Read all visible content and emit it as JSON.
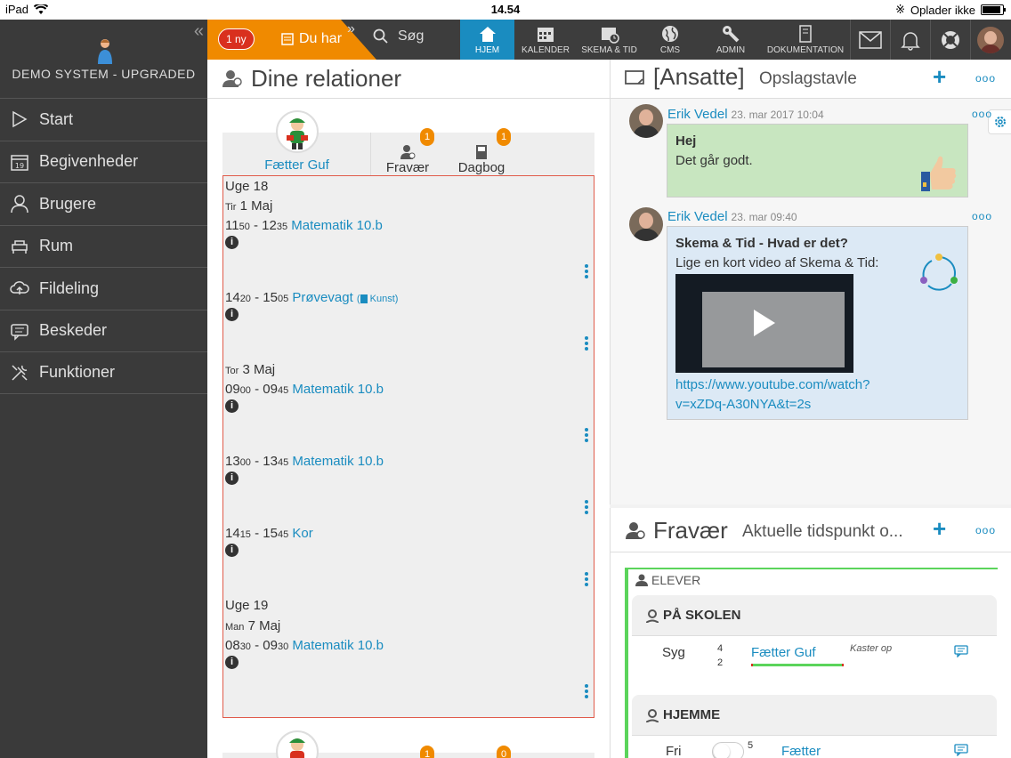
{
  "statusbar": {
    "device": "iPad",
    "time": "14.54",
    "charging": "Oplader ikke"
  },
  "sidebar": {
    "system_name": "DEMO SYSTEM - UPGRADED",
    "items": [
      {
        "label": "Start",
        "icon": "play-icon"
      },
      {
        "label": "Begivenheder",
        "icon": "calendar-icon"
      },
      {
        "label": "Brugere",
        "icon": "users-icon"
      },
      {
        "label": "Rum",
        "icon": "room-icon"
      },
      {
        "label": "Fildeling",
        "icon": "cloud-icon"
      },
      {
        "label": "Beskeder",
        "icon": "messages-icon"
      },
      {
        "label": "Funktioner",
        "icon": "tools-icon"
      }
    ]
  },
  "topnav": {
    "new_badge": "1 ny",
    "notice": "Du har",
    "search": "Søg",
    "items": [
      {
        "label": "HJEM",
        "active": true
      },
      {
        "label": "KALENDER"
      },
      {
        "label": "SKEMA & TID"
      },
      {
        "label": "CMS"
      },
      {
        "label": "ADMIN"
      },
      {
        "label": "DOKUMENTATION"
      }
    ]
  },
  "relations": {
    "title": "Dine relationer",
    "person": "Fætter Guf",
    "tabs": [
      {
        "label": "Fravær",
        "badge": "1"
      },
      {
        "label": "Dagbog",
        "badge": "1"
      }
    ],
    "schedule": {
      "week18": "Uge 18",
      "day1_small": "Tir",
      "day1": "1 Maj",
      "e1_s1": "11",
      "e1_s2": "50",
      "e1_sep": " - ",
      "e1_e1": "12",
      "e1_e2": "35",
      "e1_title": "Matematik 10.b",
      "e2_s1": "14",
      "e2_s2": "20",
      "e2_e1": "15",
      "e2_e2": "05",
      "e2_title": "Prøvevagt",
      "e2_tag": "Kunst",
      "day2_small": "Tor",
      "day2": "3 Maj",
      "e3_s1": "09",
      "e3_s2": "00",
      "e3_e1": "09",
      "e3_e2": "45",
      "e3_title": "Matematik 10.b",
      "e4_s1": "13",
      "e4_s2": "00",
      "e4_e1": "13",
      "e4_e2": "45",
      "e4_title": "Matematik 10.b",
      "e5_s1": "14",
      "e5_s2": "15",
      "e5_e1": "15",
      "e5_e2": "45",
      "e5_title": "Kor",
      "week19": "Uge 19",
      "day3_small": "Man",
      "day3": "7 Maj",
      "e6_s1": "08",
      "e6_s2": "30",
      "e6_e1": "09",
      "e6_e2": "30",
      "e6_title": "Matematik 10.b"
    },
    "second_card": {
      "badge1": "1",
      "badge2": "0"
    }
  },
  "bulletin": {
    "title": "[Ansatte]",
    "subtitle": "Opslagstavle",
    "posts": [
      {
        "author": "Erik Vedel",
        "date": "23. mar 2017 10:04",
        "heading": "Hej",
        "text": "Det går godt."
      },
      {
        "author": "Erik Vedel",
        "date": "23. mar 09:40",
        "heading": "Skema & Tid - Hvad er det?",
        "text": "Lige en kort video af Skema & Tid:",
        "link1": "https://www.youtube.com/watch?",
        "link2": "v=xZDq-A30NYA&t=2s"
      }
    ]
  },
  "absence": {
    "title": "Fravær",
    "subtitle": "Aktuelle tidspunkt o...",
    "group": "ELEVER",
    "at_school": {
      "caption": "PÅ SKOLEN",
      "reason": "Syg",
      "n1": "4",
      "n2": "2",
      "student": "Fætter Guf",
      "note": "Kaster op"
    },
    "home": {
      "caption": "HJEMME",
      "reason": "Fri",
      "n1": "5",
      "student": "Fætter"
    }
  },
  "colors": {
    "accent": "#1a8cc0",
    "orange": "#f08a00",
    "sidebar": "#3a3a3a",
    "green": "#5bd45b"
  }
}
